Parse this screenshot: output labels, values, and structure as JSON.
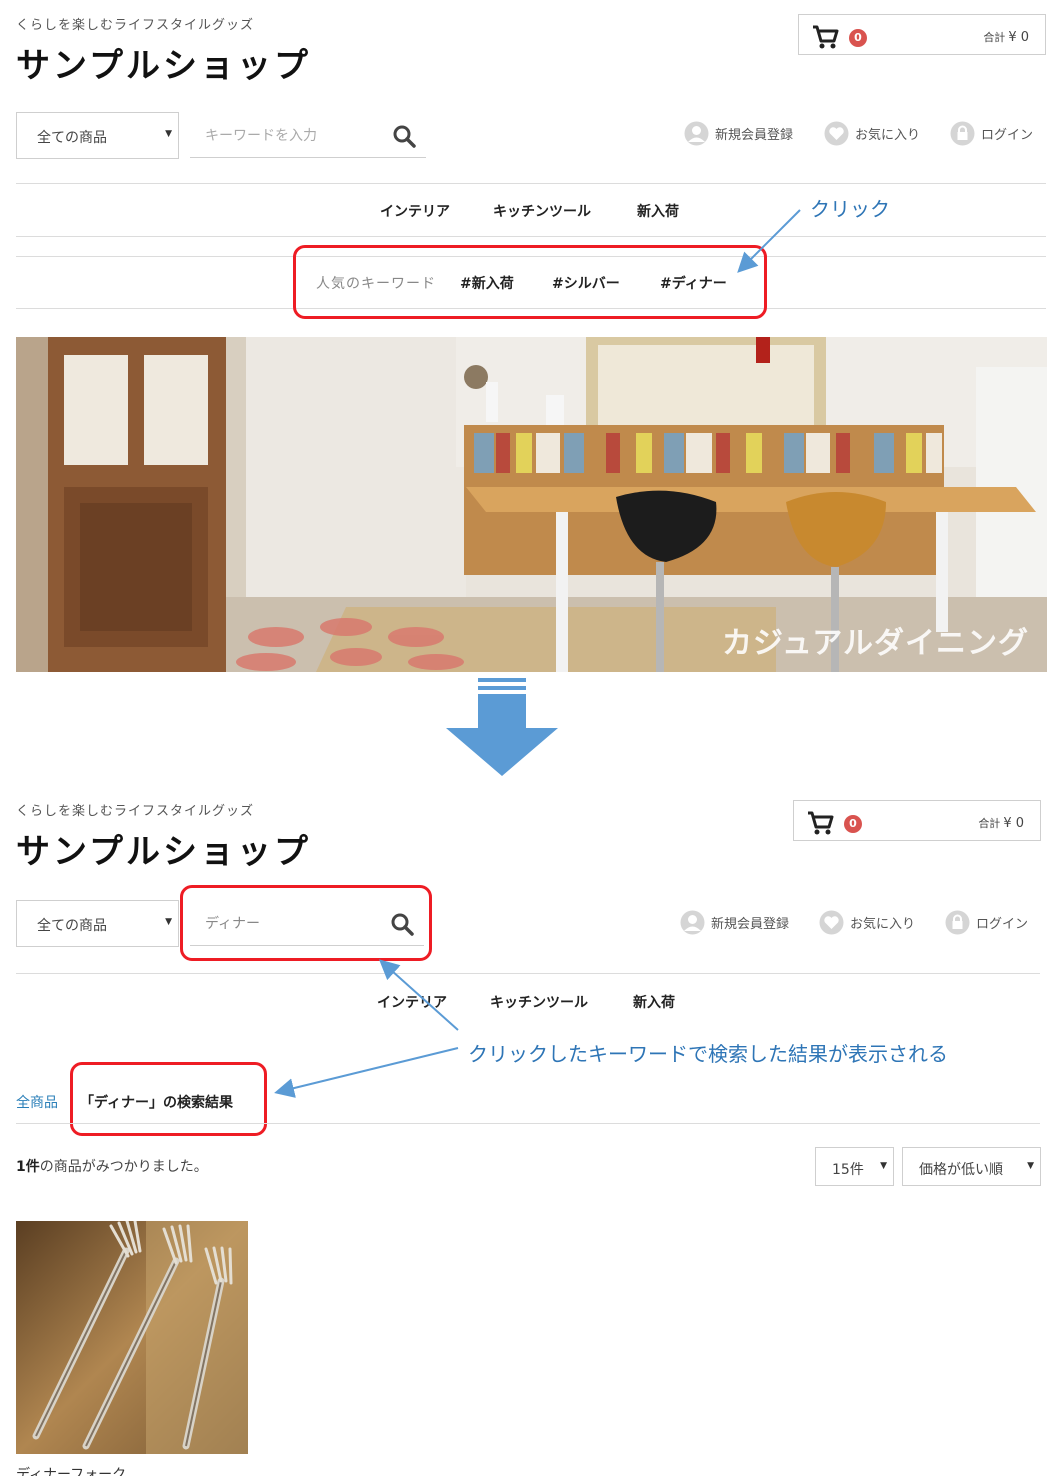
{
  "top": {
    "tagline": "くらしを楽しむライフスタイルグッズ",
    "shop_name": "サンプルショップ",
    "cart": {
      "count": "0",
      "total_label": "合計",
      "total_value": "¥ 0"
    },
    "category_select": "全ての商品",
    "search_placeholder": "キーワードを入力",
    "header_links": {
      "register": "新規会員登録",
      "favorites": "お気に入り",
      "login": "ログイン"
    },
    "nav": [
      "インテリア",
      "キッチンツール",
      "新入荷"
    ],
    "popular": {
      "label": "人気のキーワード",
      "keywords": [
        "#新入荷",
        "#シルバー",
        "#ディナー"
      ]
    },
    "hero_caption": "カジュアルダイニング",
    "annotation": "クリック"
  },
  "bottom": {
    "tagline": "くらしを楽しむライフスタイルグッズ",
    "shop_name": "サンプルショップ",
    "cart": {
      "count": "0",
      "total_label": "合計",
      "total_value": "¥ 0"
    },
    "category_select": "全ての商品",
    "search_value": "ディナー",
    "header_links": {
      "register": "新規会員登録",
      "favorites": "お気に入り",
      "login": "ログイン"
    },
    "nav": [
      "インテリア",
      "キッチンツール",
      "新入荷"
    ],
    "annotation": "クリックしたキーワードで検索した結果が表示される",
    "breadcrumb": {
      "root": "全商品",
      "current": "「ディナー」の検索結果"
    },
    "result": {
      "count": "1件",
      "suffix": "の商品がみつかりました。"
    },
    "per_page": "15件",
    "sort": "価格が低い順",
    "product_name": "ディナーフォーク"
  },
  "colors": {
    "highlight": "#ee1c24",
    "annotation": "#2e75b6",
    "badge": "#d9534f",
    "link": "#2a7fb8",
    "arrow": "#5b9bd5"
  }
}
